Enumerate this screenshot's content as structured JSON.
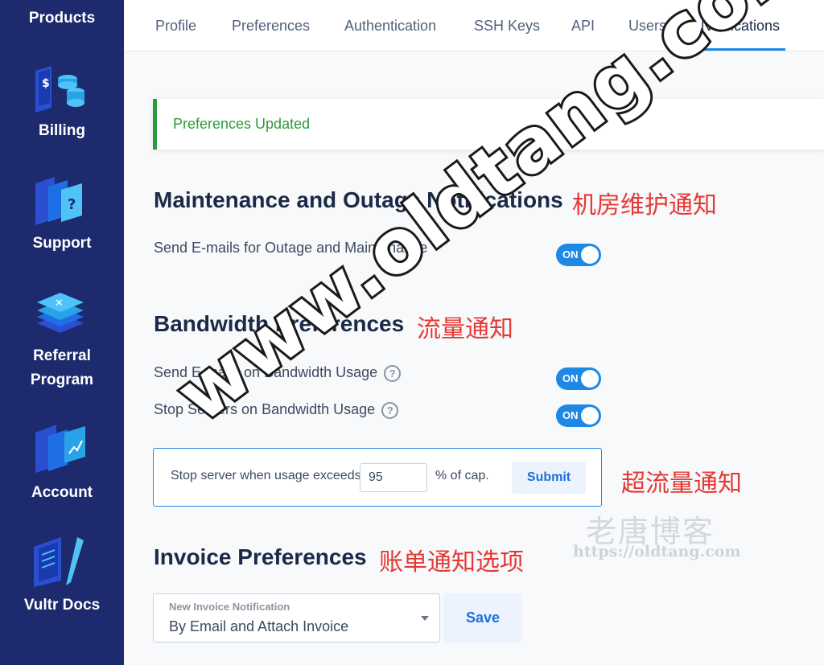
{
  "sidebar": {
    "items": [
      {
        "label": "Products",
        "icon": "products-icon"
      },
      {
        "label": "Billing",
        "icon": "billing-icon"
      },
      {
        "label": "Support",
        "icon": "support-icon"
      },
      {
        "label": "Referral Program",
        "label_line1": "Referral",
        "label_line2": "Program",
        "icon": "referral-icon"
      },
      {
        "label": "Account",
        "icon": "account-icon"
      },
      {
        "label": "Vultr Docs",
        "icon": "docs-icon"
      }
    ]
  },
  "tabs": [
    {
      "label": "Profile"
    },
    {
      "label": "Preferences"
    },
    {
      "label": "Authentication"
    },
    {
      "label": "SSH Keys"
    },
    {
      "label": "API"
    },
    {
      "label": "Users"
    },
    {
      "label": "Notifications",
      "active": true
    }
  ],
  "alert": {
    "text": "Preferences Updated",
    "color": "#2e9b3a"
  },
  "maintenance": {
    "title": "Maintenance and Outage Notifications",
    "annotation": "机房维护通知",
    "rows": [
      {
        "label": "Send E-mails for Outage and Maintenance",
        "toggle": "ON"
      }
    ]
  },
  "bandwidth": {
    "title": "Bandwidth Preferences",
    "annotation": "流量通知",
    "rows": [
      {
        "label": "Send E-mails on Bandwidth Usage",
        "toggle": "ON"
      },
      {
        "label": "Stop Servers on Bandwidth Usage",
        "toggle": "ON"
      }
    ],
    "cap": {
      "label": "Stop server when usage exceeds",
      "value": "95",
      "suffix": "% of cap.",
      "submit_label": "Submit",
      "annotation": "超流量通知"
    }
  },
  "invoice": {
    "title": "Invoice Preferences",
    "annotation": "账单通知选项",
    "select_caption": "New Invoice Notification",
    "select_value": "By Email and Attach Invoice",
    "save_label": "Save"
  },
  "watermark": {
    "text": "www.oldtang.com",
    "brand_cn": "老唐博客",
    "brand_url": "https://oldtang.com"
  },
  "colors": {
    "sidebar_bg": "#1d2b6e",
    "accent": "#1e88e5",
    "annotation": "#e53935",
    "success": "#2e9b3a"
  }
}
